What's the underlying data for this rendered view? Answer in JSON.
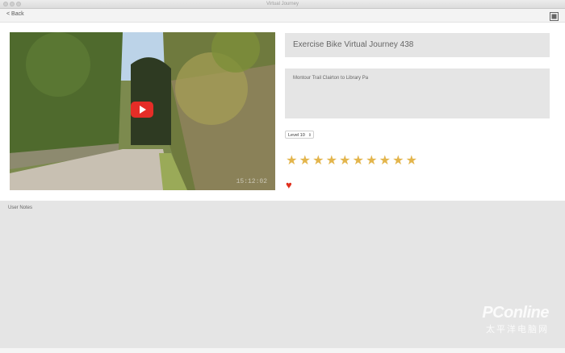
{
  "window": {
    "title": "Virtual Journey"
  },
  "nav": {
    "back_label": "< Back"
  },
  "video": {
    "timestamp": "15:12:02"
  },
  "journey": {
    "title": "Exercise Bike Virtual Journey 438",
    "description": "Montour Trail Clairton to Library Pa",
    "level": "Level 10",
    "rating": 10,
    "favorite": true
  },
  "notes": {
    "label": "User Notes"
  },
  "watermark": {
    "brand": "PConline",
    "sub": "太平洋电脑网"
  },
  "colors": {
    "star": "#e3b54c",
    "heart": "#e0301e",
    "play": "#e52d27",
    "panel": "#e5e5e5"
  }
}
